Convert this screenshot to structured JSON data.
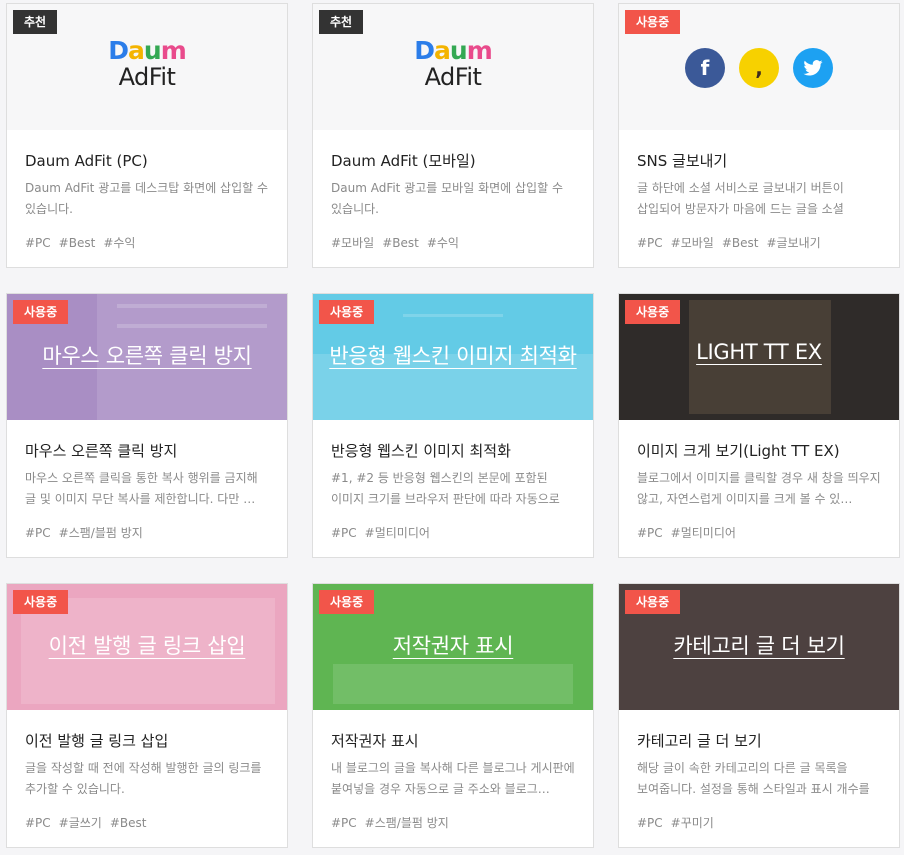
{
  "cards": [
    {
      "badge": "추천",
      "title": "Daum AdFit (PC)",
      "desc": "Daum AdFit 광고를 데스크탑 화면에 삽입할 수 있습니다.",
      "tags": [
        "#PC",
        "#Best",
        "#수익"
      ],
      "logo_top": "Daum",
      "logo_bottom": "AdFit"
    },
    {
      "badge": "추천",
      "title": "Daum AdFit (모바일)",
      "desc": "Daum AdFit 광고를 모바일 화면에 삽입할 수 있습니다.",
      "tags": [
        "#모바일",
        "#Best",
        "#수익"
      ],
      "logo_top": "Daum",
      "logo_bottom": "AdFit"
    },
    {
      "badge": "사용중",
      "title": "SNS 글보내기",
      "desc": "글 하단에 소셜 서비스로 글보내기 버튼이 삽입되어 방문자가 마음에 드는 글을 소셜 서비스…",
      "tags": [
        "#PC",
        "#모바일",
        "#Best",
        "#글보내기"
      ],
      "icons": [
        "facebook-icon",
        "kakaostory-icon",
        "twitter-icon"
      ]
    },
    {
      "badge": "사용중",
      "title": "마우스 오른쪽 클릭 방지",
      "desc": "마우스 오른쪽 클릭을 통한 복사 행위를 금지해 글 및 이미지 무단 복사를 제한합니다. 다만 …",
      "tags": [
        "#PC",
        "#스팸/블펌 방지"
      ],
      "banner": "마우스 오른쪽 클릭 방지",
      "color": "#a98ec4"
    },
    {
      "badge": "사용중",
      "title": "반응형 웹스킨 이미지 최적화",
      "desc": "#1, #2 등 반응형 웹스킨의 본문에 포함된 이미지 크기를 브라우저 판단에 따라 자동으로 조…",
      "tags": [
        "#PC",
        "#멀티미디어"
      ],
      "banner": "반응형 웹스킨 이미지 최적화",
      "color": "#63cbe6"
    },
    {
      "badge": "사용중",
      "title": "이미지 크게 보기(Light TT EX)",
      "desc": "블로그에서 이미지를 클릭할 경우 새 창을 띄우지 않고, 자연스럽게 이미지를 크게 볼 수 있…",
      "tags": [
        "#PC",
        "#멀티미디어"
      ],
      "banner": "LIGHT TT EX",
      "color": "#2f2b29"
    },
    {
      "badge": "사용중",
      "title": "이전 발행 글 링크 삽입",
      "desc": "글을 작성할 때 전에 작성해 발행한 글의 링크를 추가할 수 있습니다.",
      "tags": [
        "#PC",
        "#글쓰기",
        "#Best"
      ],
      "banner": "이전 발행 글 링크 삽입",
      "color": "#eba6c0"
    },
    {
      "badge": "사용중",
      "title": "저작권자 표시",
      "desc": "내 블로그의 글을 복사해 다른 블로그나 게시판에 붙여넣을 경우 자동으로 글 주소와 블로그…",
      "tags": [
        "#PC",
        "#스팸/블펌 방지"
      ],
      "banner": "저작권자 표시",
      "color": "#5fb552"
    },
    {
      "badge": "사용중",
      "title": "카테고리 글 더 보기",
      "desc": "해당 글이 속한 카테고리의 다른 글 목록을 보여줍니다. 설정을 통해 스타일과 표시 개수를 변…",
      "tags": [
        "#PC",
        "#꾸미기"
      ],
      "banner": "카테고리 글 더 보기",
      "color": "#4d4140"
    }
  ]
}
